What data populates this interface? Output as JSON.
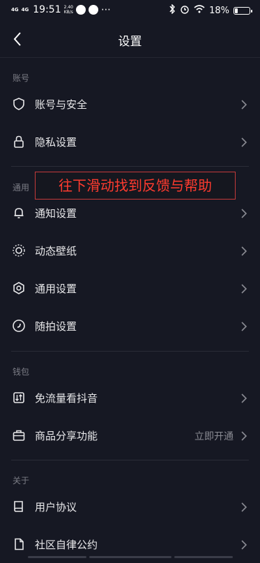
{
  "status_bar": {
    "signal1": "4G",
    "signal2": "4G",
    "time": "19:51",
    "speed_value": "2.40",
    "speed_unit": "KB/s",
    "battery": "18%",
    "battery_level": 0.18
  },
  "nav": {
    "title": "设置"
  },
  "sections": {
    "account": {
      "label": "账号"
    },
    "general": {
      "label": "通用"
    },
    "wallet": {
      "label": "钱包"
    },
    "about": {
      "label": "关于"
    }
  },
  "rows": {
    "account_security": "账号与安全",
    "privacy": "隐私设置",
    "notifications": "通知设置",
    "dynamic_wallpaper": "动态壁纸",
    "general_settings": "通用设置",
    "snap_settings": "随拍设置",
    "free_data": "免流量看抖音",
    "product_share": "商品分享功能",
    "product_share_action": "立即开通",
    "user_agreement": "用户协议",
    "community_rules": "社区自律公约"
  },
  "overlay": {
    "text": "往下滑动找到反馈与帮助"
  }
}
